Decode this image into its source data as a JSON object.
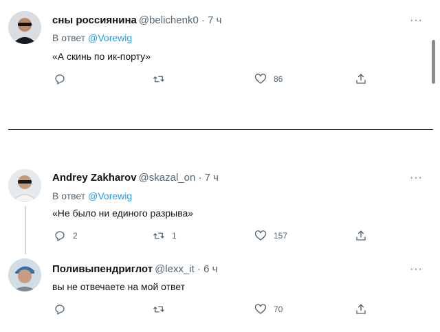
{
  "tweets": [
    {
      "name": "сны россиянина",
      "meta": "@belichenk0 · 7 ч",
      "reply_label": "В ответ",
      "reply_handle": "@Vorewig",
      "text": "«А скинь по ик-порту»",
      "more": "···",
      "reply_count": "",
      "retweet_count": "",
      "like_count": "86"
    },
    {
      "name": "Andrey Zakharov",
      "meta": "@skazal_on · 7 ч",
      "reply_label": "В ответ",
      "reply_handle": "@Vorewig",
      "text": "«Не было ни единого разрыва»",
      "more": "···",
      "reply_count": "2",
      "retweet_count": "1",
      "like_count": "157"
    },
    {
      "name": "Поливыпендриглот",
      "meta": "@lexx_it · 6 ч",
      "text": "вы не отвечаете на мой ответ",
      "more": "···",
      "reply_count": "",
      "retweet_count": "",
      "like_count": "70"
    }
  ],
  "icons": {
    "reply": "reply-icon",
    "retweet": "retweet-icon",
    "like": "heart-icon",
    "share": "share-icon",
    "more": "more-icon"
  },
  "colors": {
    "link": "#1d9bf0",
    "secondary_text": "#536471",
    "primary_text": "#0f1419"
  }
}
